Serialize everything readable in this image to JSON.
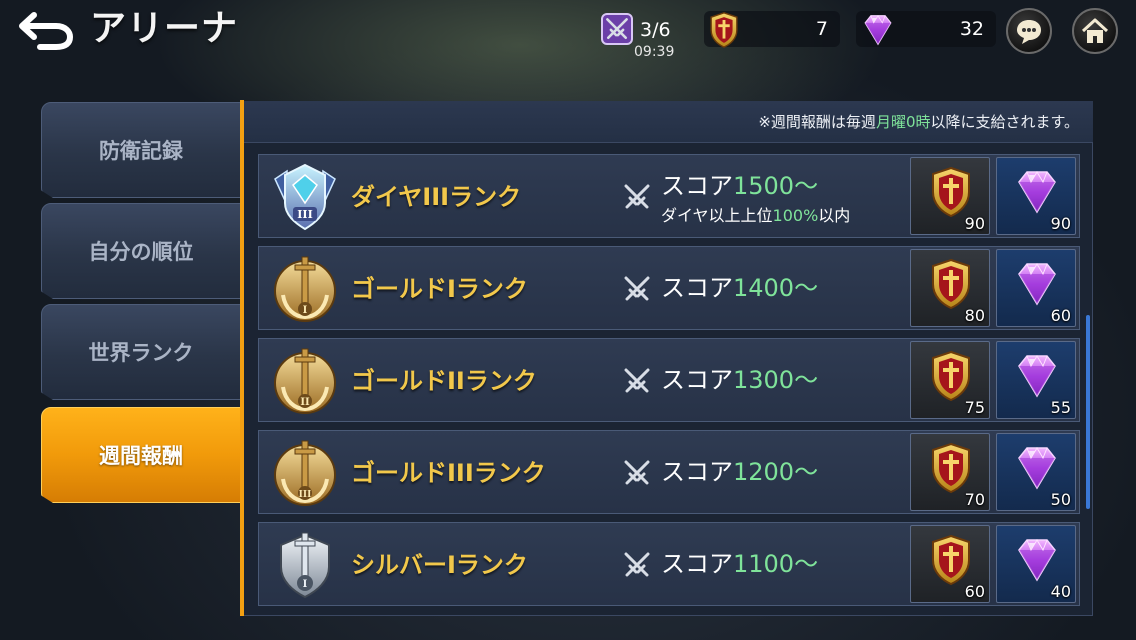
{
  "header": {
    "title": "アリーナ",
    "entries": "3/6",
    "timer": "09:39",
    "shield_currency": "7",
    "gem_currency": "32"
  },
  "tabs": [
    {
      "label": "防衛記録",
      "active": false
    },
    {
      "label": "自分の順位",
      "active": false
    },
    {
      "label": "世界ランク",
      "active": false
    },
    {
      "label": "週間報酬",
      "active": true
    }
  ],
  "notice": {
    "prefix": "※週間報酬は毎週",
    "highlight": "月曜0時",
    "suffix": "以降に支給されます。"
  },
  "rewards": [
    {
      "rank": "ダイヤIIIランク",
      "badge": "diamond-badge-3",
      "score_label": "スコア",
      "score": "1500〜",
      "condition_prefix": "ダイヤ以上上位",
      "condition_value": "100%",
      "condition_suffix": "以内",
      "shield_qty": "90",
      "gem_qty": "90"
    },
    {
      "rank": "ゴールドIランク",
      "badge": "gold-badge-1",
      "score_label": "スコア",
      "score": "1400〜",
      "shield_qty": "80",
      "gem_qty": "60"
    },
    {
      "rank": "ゴールドIIランク",
      "badge": "gold-badge-2",
      "score_label": "スコア",
      "score": "1300〜",
      "shield_qty": "75",
      "gem_qty": "55"
    },
    {
      "rank": "ゴールドIIIランク",
      "badge": "gold-badge-3",
      "score_label": "スコア",
      "score": "1200〜",
      "shield_qty": "70",
      "gem_qty": "50"
    },
    {
      "rank": "シルバーIランク",
      "badge": "silver-badge-1",
      "score_label": "スコア",
      "score": "1100〜",
      "shield_qty": "60",
      "gem_qty": "40"
    }
  ],
  "colors": {
    "accent_orange": "#f3a012",
    "rank_gold_text": "#f2c84b",
    "score_green": "#7fe39a",
    "panel_bg": "#1b2433"
  }
}
